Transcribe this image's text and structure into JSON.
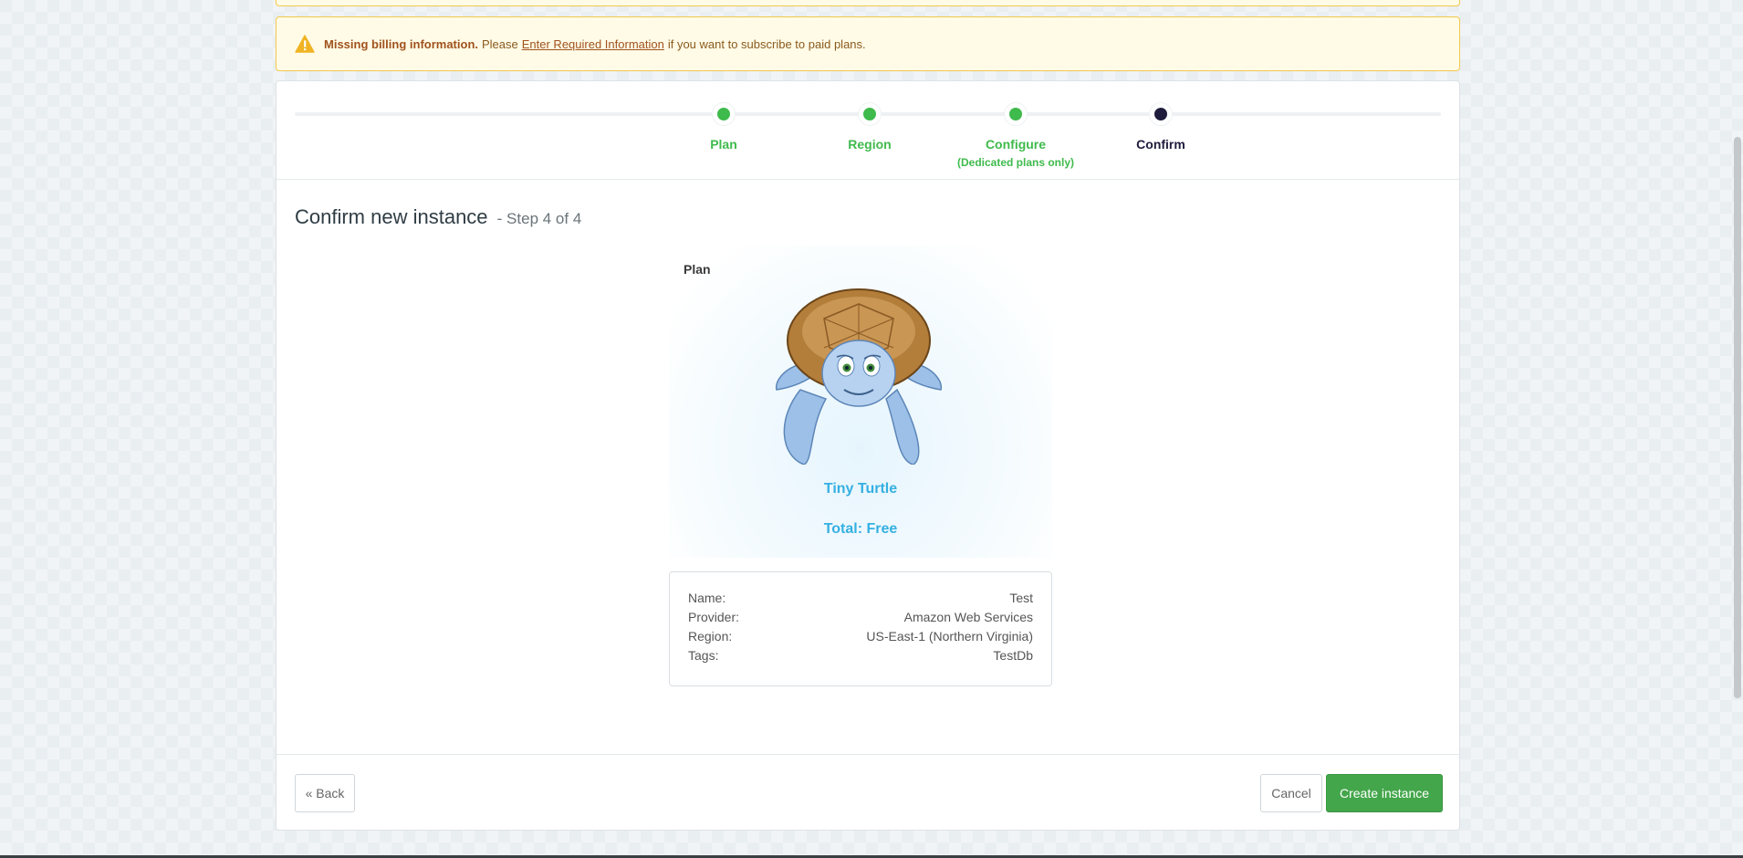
{
  "alert": {
    "title": "Missing billing information.",
    "text_before": "Please",
    "link": "Enter Required Information",
    "text_after": "if you want to subscribe to paid plans.",
    "icon": "warning-icon"
  },
  "stepper": {
    "steps": [
      {
        "label": "Plan",
        "sub": "",
        "state": "complete"
      },
      {
        "label": "Region",
        "sub": "",
        "state": "complete"
      },
      {
        "label": "Configure",
        "sub": "(Dedicated plans only)",
        "state": "complete"
      },
      {
        "label": "Confirm",
        "sub": "",
        "state": "active"
      }
    ],
    "colors": {
      "complete": "#3fba4c",
      "active": "#1f1c3d"
    }
  },
  "heading": {
    "title": "Confirm new instance",
    "step_count": "- Step 4 of 4"
  },
  "plan": {
    "label": "Plan",
    "name": "Tiny Turtle",
    "total": "Total: Free",
    "image": "turtle-illustration"
  },
  "details": {
    "rows": [
      {
        "key": "Name:",
        "value": "Test"
      },
      {
        "key": "Provider:",
        "value": "Amazon Web Services"
      },
      {
        "key": "Region:",
        "value": "US-East-1 (Northern Virginia)"
      },
      {
        "key": "Tags:",
        "value": "TestDb"
      }
    ]
  },
  "buttons": {
    "back": "« Back",
    "cancel": "Cancel",
    "create": "Create instance"
  },
  "colors": {
    "accent": "#43a64b",
    "plan_text": "#35b0e2",
    "alert_bg": "#fffbe6",
    "alert_border": "#f3c84c"
  }
}
